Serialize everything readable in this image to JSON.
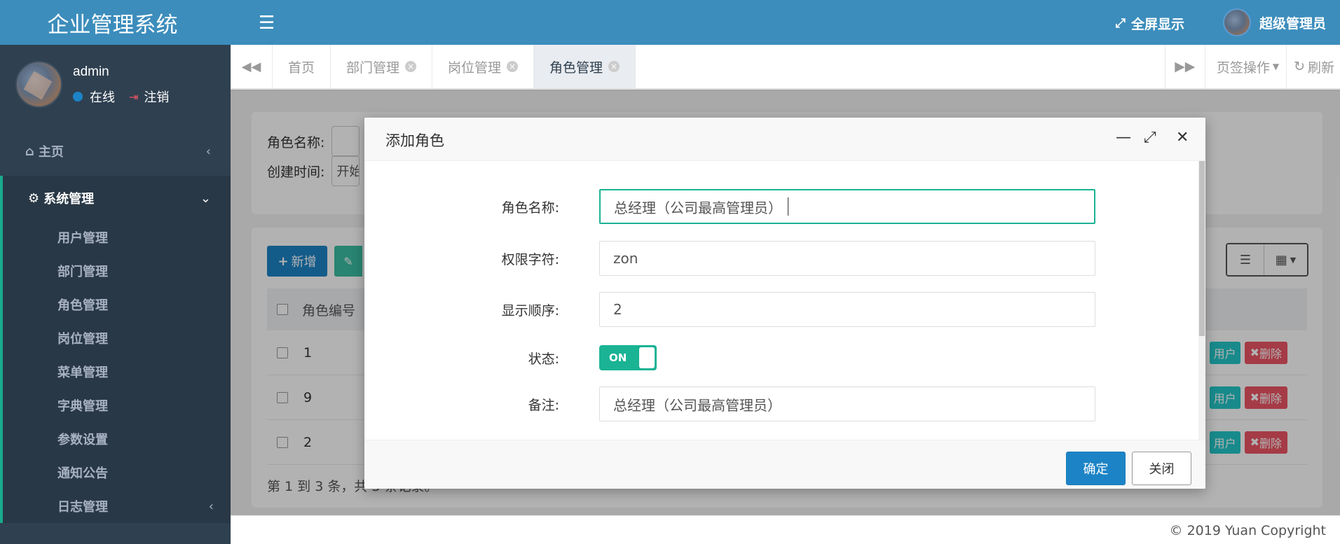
{
  "brand": {
    "title": "企业管理系统"
  },
  "user": {
    "name": "admin",
    "status": "在线",
    "logout": "注销"
  },
  "menu": {
    "home": "主页",
    "system": "系统管理",
    "items": [
      "用户管理",
      "部门管理",
      "角色管理",
      "岗位管理",
      "菜单管理",
      "字典管理",
      "参数设置",
      "通知公告",
      "日志管理"
    ]
  },
  "topbar": {
    "fullscreen": "全屏显示",
    "admin": "超级管理员"
  },
  "tabs": {
    "items": [
      {
        "label": "首页"
      },
      {
        "label": "部门管理"
      },
      {
        "label": "岗位管理"
      },
      {
        "label": "角色管理"
      }
    ],
    "ops": "页签操作",
    "refresh": "刷新"
  },
  "search": {
    "role_name_label": "角色名称:",
    "created_label": "创建时间:",
    "created_placeholder": "开始"
  },
  "table": {
    "add_label": "新增",
    "header_id": "角色编号",
    "rows": [
      {
        "id": "1",
        "assign": "用户",
        "delete": "删除"
      },
      {
        "id": "9",
        "assign": "用户",
        "delete": "删除"
      },
      {
        "id": "2",
        "assign": "用户",
        "delete": "删除"
      }
    ],
    "pager": "第 1 到 3 条，共 3 条记录。"
  },
  "footer": {
    "copyright": "© 2019 Yuan Copyright"
  },
  "modal": {
    "title": "添加角色",
    "fields": {
      "role_name": {
        "label": "角色名称:",
        "value": "总经理（公司最高管理员）"
      },
      "perm_key": {
        "label": "权限字符:",
        "value": "zon"
      },
      "order": {
        "label": "显示顺序:",
        "value": "2"
      },
      "status": {
        "label": "状态:",
        "value": "ON"
      },
      "remark": {
        "label": "备注:",
        "value": "总经理（公司最高管理员）"
      }
    },
    "ok": "确定",
    "close": "关闭"
  },
  "colors": {
    "primary": "#3c8dbc",
    "sidebar": "#2f4050",
    "accent": "#1ab394",
    "button_blue": "#1c84c6",
    "danger": "#ed5565"
  }
}
